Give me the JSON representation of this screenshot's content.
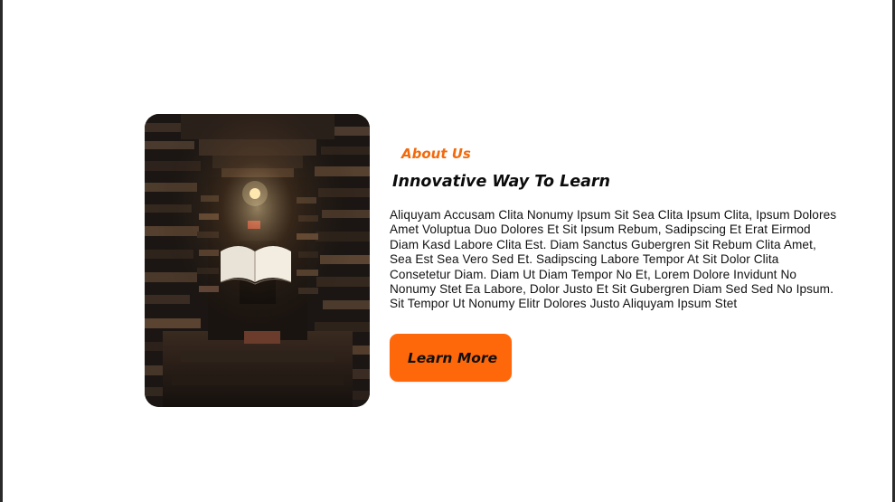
{
  "about": {
    "eyebrow": "About Us",
    "title": "Innovative Way To Learn",
    "body": "Aliquyam Accusam Clita Nonumy Ipsum Sit Sea Clita Ipsum Clita, Ipsum Dolores Amet Voluptua Duo Dolores Et Sit Ipsum Rebum, Sadipscing Et Erat Eirmod Diam Kasd Labore Clita Est. Diam Sanctus Gubergren Sit Rebum Clita Amet, Sea Est Sea Vero Sed Et. Sadipscing Labore Tempor At Sit Dolor Clita Consetetur Diam. Diam Ut Diam Tempor No Et, Lorem Dolore Invidunt No Nonumy Stet Ea Labore, Dolor Justo Et Sit Gubergren Diam Sed Sed No Ipsum. Sit Tempor Ut Nonumy Elitr Dolores Justo Aliquyam Ipsum Stet",
    "button_label": "Learn More"
  },
  "colors": {
    "accent": "#ff680a",
    "eyebrow": "#f26a0c",
    "text": "#111111"
  }
}
